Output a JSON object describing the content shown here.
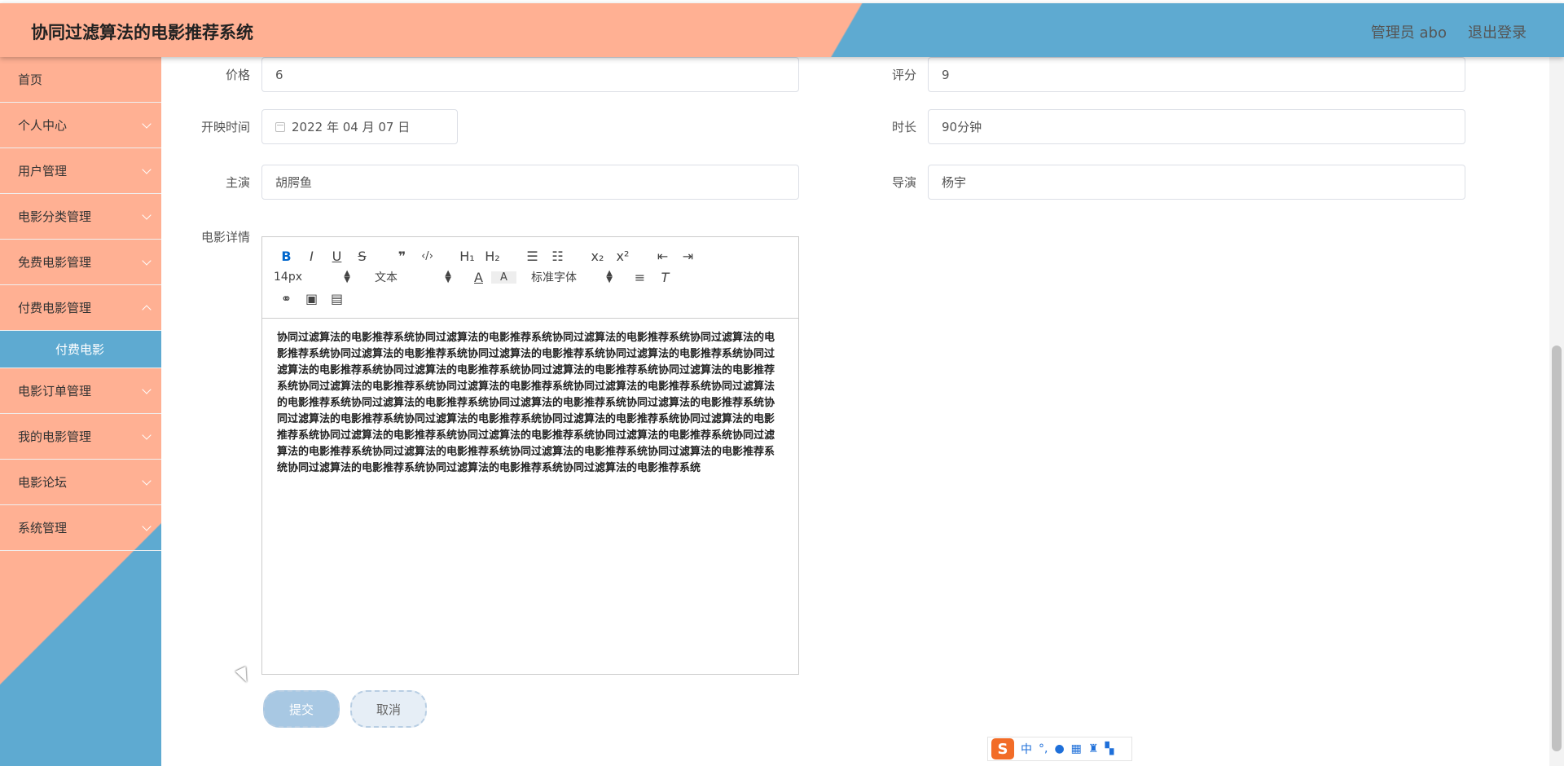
{
  "header": {
    "title": "协同过滤算法的电影推荐系统",
    "user_label": "管理员 abo",
    "logout_label": "退出登录"
  },
  "sidebar": {
    "items": [
      {
        "label": "首页",
        "has_children": false
      },
      {
        "label": "个人中心",
        "has_children": true
      },
      {
        "label": "用户管理",
        "has_children": true
      },
      {
        "label": "电影分类管理",
        "has_children": true
      },
      {
        "label": "免费电影管理",
        "has_children": true
      },
      {
        "label": "付费电影管理",
        "has_children": true
      },
      {
        "label": "电影订单管理",
        "has_children": true
      },
      {
        "label": "我的电影管理",
        "has_children": true
      },
      {
        "label": "电影论坛",
        "has_children": true
      },
      {
        "label": "系统管理",
        "has_children": true
      }
    ],
    "active_submenu": "付费电影"
  },
  "form": {
    "price": {
      "label": "价格",
      "value": "6"
    },
    "score": {
      "label": "评分",
      "value": "9"
    },
    "release": {
      "label": "开映时间",
      "value": "2022 年 04 月 07 日"
    },
    "duration": {
      "label": "时长",
      "value": "90分钟"
    },
    "actor": {
      "label": "主演",
      "value": "胡腭鱼"
    },
    "director": {
      "label": "导演",
      "value": "杨宇"
    },
    "details_label": "电影详情"
  },
  "editor": {
    "font_size": "14px",
    "paragraph": "文本",
    "font_family": "标准字体",
    "content": "协同过滤算法的电影推荐系统协同过滤算法的电影推荐系统协同过滤算法的电影推荐系统协同过滤算法的电影推荐系统协同过滤算法的电影推荐系统协同过滤算法的电影推荐系统协同过滤算法的电影推荐系统协同过滤算法的电影推荐系统协同过滤算法的电影推荐系统协同过滤算法的电影推荐系统协同过滤算法的电影推荐系统协同过滤算法的电影推荐系统协同过滤算法的电影推荐系统协同过滤算法的电影推荐系统协同过滤算法的电影推荐系统协同过滤算法的电影推荐系统协同过滤算法的电影推荐系统协同过滤算法的电影推荐系统协同过滤算法的电影推荐系统协同过滤算法的电影推荐系统协同过滤算法的电影推荐系统协同过滤算法的电影推荐系统协同过滤算法的电影推荐系统协同过滤算法的电影推荐系统协同过滤算法的电影推荐系统协同过滤算法的电影推荐系统协同过滤算法的电影推荐系统协同过滤算法的电影推荐系统协同过滤算法的电影推荐系统协同过滤算法的电影推荐系统协同过滤算法的电影推荐系统协同过滤算法的电影推荐系统"
  },
  "buttons": {
    "submit": "提交",
    "cancel": "取消"
  },
  "ime": {
    "mode": "中"
  }
}
